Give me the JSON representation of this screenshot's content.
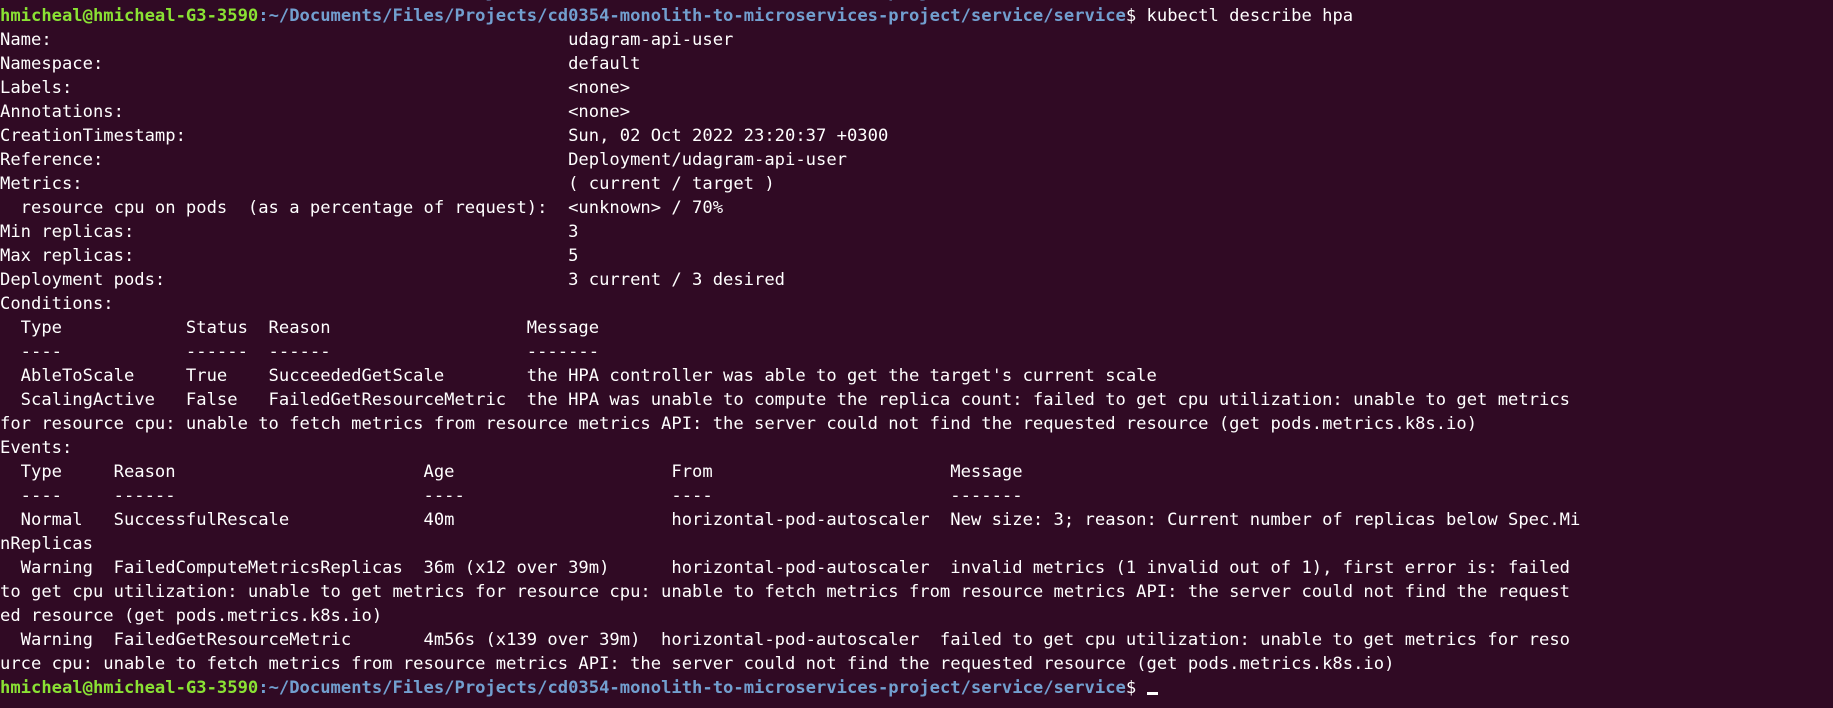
{
  "prompt": {
    "user_host": "hmicheal@hmicheal-G3-3590",
    "path": ":~/Documents/Files/Projects/cd0354-monolith-to-microservices-project/service/service",
    "symbol": "$ ",
    "command": "kubectl describe hpa"
  },
  "output_lines": [
    "Name:                                                  udagram-api-user",
    "Namespace:                                             default",
    "Labels:                                                <none>",
    "Annotations:                                           <none>",
    "CreationTimestamp:                                     Sun, 02 Oct 2022 23:20:37 +0300",
    "Reference:                                             Deployment/udagram-api-user",
    "Metrics:                                               ( current / target )",
    "  resource cpu on pods  (as a percentage of request):  <unknown> / 70%",
    "Min replicas:                                          3",
    "Max replicas:                                          5",
    "Deployment pods:                                       3 current / 3 desired",
    "Conditions:",
    "  Type            Status  Reason                   Message",
    "  ----            ------  ------                   -------",
    "  AbleToScale     True    SucceededGetScale        the HPA controller was able to get the target's current scale",
    "  ScalingActive   False   FailedGetResourceMetric  the HPA was unable to compute the replica count: failed to get cpu utilization: unable to get metrics",
    "for resource cpu: unable to fetch metrics from resource metrics API: the server could not find the requested resource (get pods.metrics.k8s.io)",
    "Events:",
    "  Type     Reason                        Age                     From                       Message",
    "  ----     ------                        ----                    ----                       -------",
    "  Normal   SuccessfulRescale             40m                     horizontal-pod-autoscaler  New size: 3; reason: Current number of replicas below Spec.Mi",
    "nReplicas",
    "  Warning  FailedComputeMetricsReplicas  36m (x12 over 39m)      horizontal-pod-autoscaler  invalid metrics (1 invalid out of 1), first error is: failed",
    "to get cpu utilization: unable to get metrics for resource cpu: unable to fetch metrics from resource metrics API: the server could not find the request",
    "ed resource (get pods.metrics.k8s.io)",
    "  Warning  FailedGetResourceMetric       4m56s (x139 over 39m)  horizontal-pod-autoscaler  failed to get cpu utilization: unable to get metrics for reso",
    "urce cpu: unable to fetch metrics from resource metrics API: the server could not find the requested resource (get pods.metrics.k8s.io)"
  ],
  "colors": {
    "background": "#300a24",
    "user_host": "#8ae234",
    "path": "#729fcf",
    "text": "#ffffff"
  }
}
